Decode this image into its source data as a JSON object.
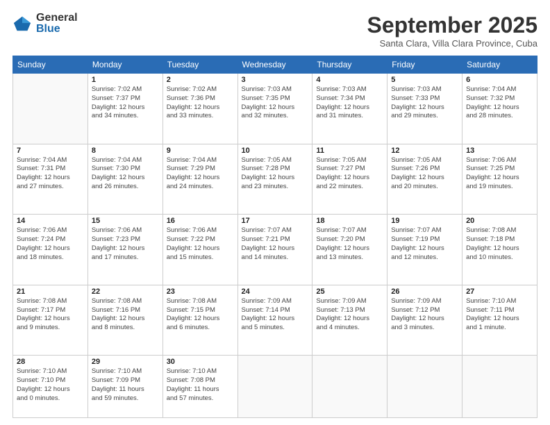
{
  "logo": {
    "general": "General",
    "blue": "Blue"
  },
  "header": {
    "title": "September 2025",
    "location": "Santa Clara, Villa Clara Province, Cuba"
  },
  "weekdays": [
    "Sunday",
    "Monday",
    "Tuesday",
    "Wednesday",
    "Thursday",
    "Friday",
    "Saturday"
  ],
  "weeks": [
    [
      {
        "day": "",
        "info": ""
      },
      {
        "day": "1",
        "info": "Sunrise: 7:02 AM\nSunset: 7:37 PM\nDaylight: 12 hours\nand 34 minutes."
      },
      {
        "day": "2",
        "info": "Sunrise: 7:02 AM\nSunset: 7:36 PM\nDaylight: 12 hours\nand 33 minutes."
      },
      {
        "day": "3",
        "info": "Sunrise: 7:03 AM\nSunset: 7:35 PM\nDaylight: 12 hours\nand 32 minutes."
      },
      {
        "day": "4",
        "info": "Sunrise: 7:03 AM\nSunset: 7:34 PM\nDaylight: 12 hours\nand 31 minutes."
      },
      {
        "day": "5",
        "info": "Sunrise: 7:03 AM\nSunset: 7:33 PM\nDaylight: 12 hours\nand 29 minutes."
      },
      {
        "day": "6",
        "info": "Sunrise: 7:04 AM\nSunset: 7:32 PM\nDaylight: 12 hours\nand 28 minutes."
      }
    ],
    [
      {
        "day": "7",
        "info": "Sunrise: 7:04 AM\nSunset: 7:31 PM\nDaylight: 12 hours\nand 27 minutes."
      },
      {
        "day": "8",
        "info": "Sunrise: 7:04 AM\nSunset: 7:30 PM\nDaylight: 12 hours\nand 26 minutes."
      },
      {
        "day": "9",
        "info": "Sunrise: 7:04 AM\nSunset: 7:29 PM\nDaylight: 12 hours\nand 24 minutes."
      },
      {
        "day": "10",
        "info": "Sunrise: 7:05 AM\nSunset: 7:28 PM\nDaylight: 12 hours\nand 23 minutes."
      },
      {
        "day": "11",
        "info": "Sunrise: 7:05 AM\nSunset: 7:27 PM\nDaylight: 12 hours\nand 22 minutes."
      },
      {
        "day": "12",
        "info": "Sunrise: 7:05 AM\nSunset: 7:26 PM\nDaylight: 12 hours\nand 20 minutes."
      },
      {
        "day": "13",
        "info": "Sunrise: 7:06 AM\nSunset: 7:25 PM\nDaylight: 12 hours\nand 19 minutes."
      }
    ],
    [
      {
        "day": "14",
        "info": "Sunrise: 7:06 AM\nSunset: 7:24 PM\nDaylight: 12 hours\nand 18 minutes."
      },
      {
        "day": "15",
        "info": "Sunrise: 7:06 AM\nSunset: 7:23 PM\nDaylight: 12 hours\nand 17 minutes."
      },
      {
        "day": "16",
        "info": "Sunrise: 7:06 AM\nSunset: 7:22 PM\nDaylight: 12 hours\nand 15 minutes."
      },
      {
        "day": "17",
        "info": "Sunrise: 7:07 AM\nSunset: 7:21 PM\nDaylight: 12 hours\nand 14 minutes."
      },
      {
        "day": "18",
        "info": "Sunrise: 7:07 AM\nSunset: 7:20 PM\nDaylight: 12 hours\nand 13 minutes."
      },
      {
        "day": "19",
        "info": "Sunrise: 7:07 AM\nSunset: 7:19 PM\nDaylight: 12 hours\nand 12 minutes."
      },
      {
        "day": "20",
        "info": "Sunrise: 7:08 AM\nSunset: 7:18 PM\nDaylight: 12 hours\nand 10 minutes."
      }
    ],
    [
      {
        "day": "21",
        "info": "Sunrise: 7:08 AM\nSunset: 7:17 PM\nDaylight: 12 hours\nand 9 minutes."
      },
      {
        "day": "22",
        "info": "Sunrise: 7:08 AM\nSunset: 7:16 PM\nDaylight: 12 hours\nand 8 minutes."
      },
      {
        "day": "23",
        "info": "Sunrise: 7:08 AM\nSunset: 7:15 PM\nDaylight: 12 hours\nand 6 minutes."
      },
      {
        "day": "24",
        "info": "Sunrise: 7:09 AM\nSunset: 7:14 PM\nDaylight: 12 hours\nand 5 minutes."
      },
      {
        "day": "25",
        "info": "Sunrise: 7:09 AM\nSunset: 7:13 PM\nDaylight: 12 hours\nand 4 minutes."
      },
      {
        "day": "26",
        "info": "Sunrise: 7:09 AM\nSunset: 7:12 PM\nDaylight: 12 hours\nand 3 minutes."
      },
      {
        "day": "27",
        "info": "Sunrise: 7:10 AM\nSunset: 7:11 PM\nDaylight: 12 hours\nand 1 minute."
      }
    ],
    [
      {
        "day": "28",
        "info": "Sunrise: 7:10 AM\nSunset: 7:10 PM\nDaylight: 12 hours\nand 0 minutes."
      },
      {
        "day": "29",
        "info": "Sunrise: 7:10 AM\nSunset: 7:09 PM\nDaylight: 11 hours\nand 59 minutes."
      },
      {
        "day": "30",
        "info": "Sunrise: 7:10 AM\nSunset: 7:08 PM\nDaylight: 11 hours\nand 57 minutes."
      },
      {
        "day": "",
        "info": ""
      },
      {
        "day": "",
        "info": ""
      },
      {
        "day": "",
        "info": ""
      },
      {
        "day": "",
        "info": ""
      }
    ]
  ]
}
